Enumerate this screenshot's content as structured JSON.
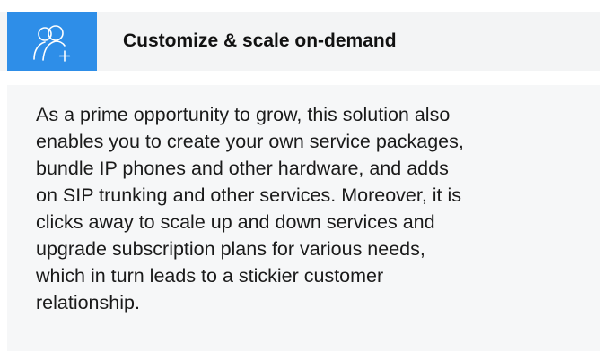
{
  "card": {
    "icon": "users-add-icon",
    "title": "Customize & scale on-demand",
    "body_lines": [
      "As a prime opportunity to grow, this solution also",
      "enables you to create your own service packages,",
      "bundle IP phones and other hardware, and adds",
      "on SIP trunking and other services. Moreover, it is",
      "clicks away to scale up and down services and",
      "upgrade subscription plans for various needs,",
      "which in turn leads to a stickier customer",
      "relationship."
    ]
  },
  "colors": {
    "accent": "#2e8ee8",
    "header_bg": "#f3f4f5",
    "body_bg": "#f6f7f8",
    "text": "#1a1a1a"
  }
}
